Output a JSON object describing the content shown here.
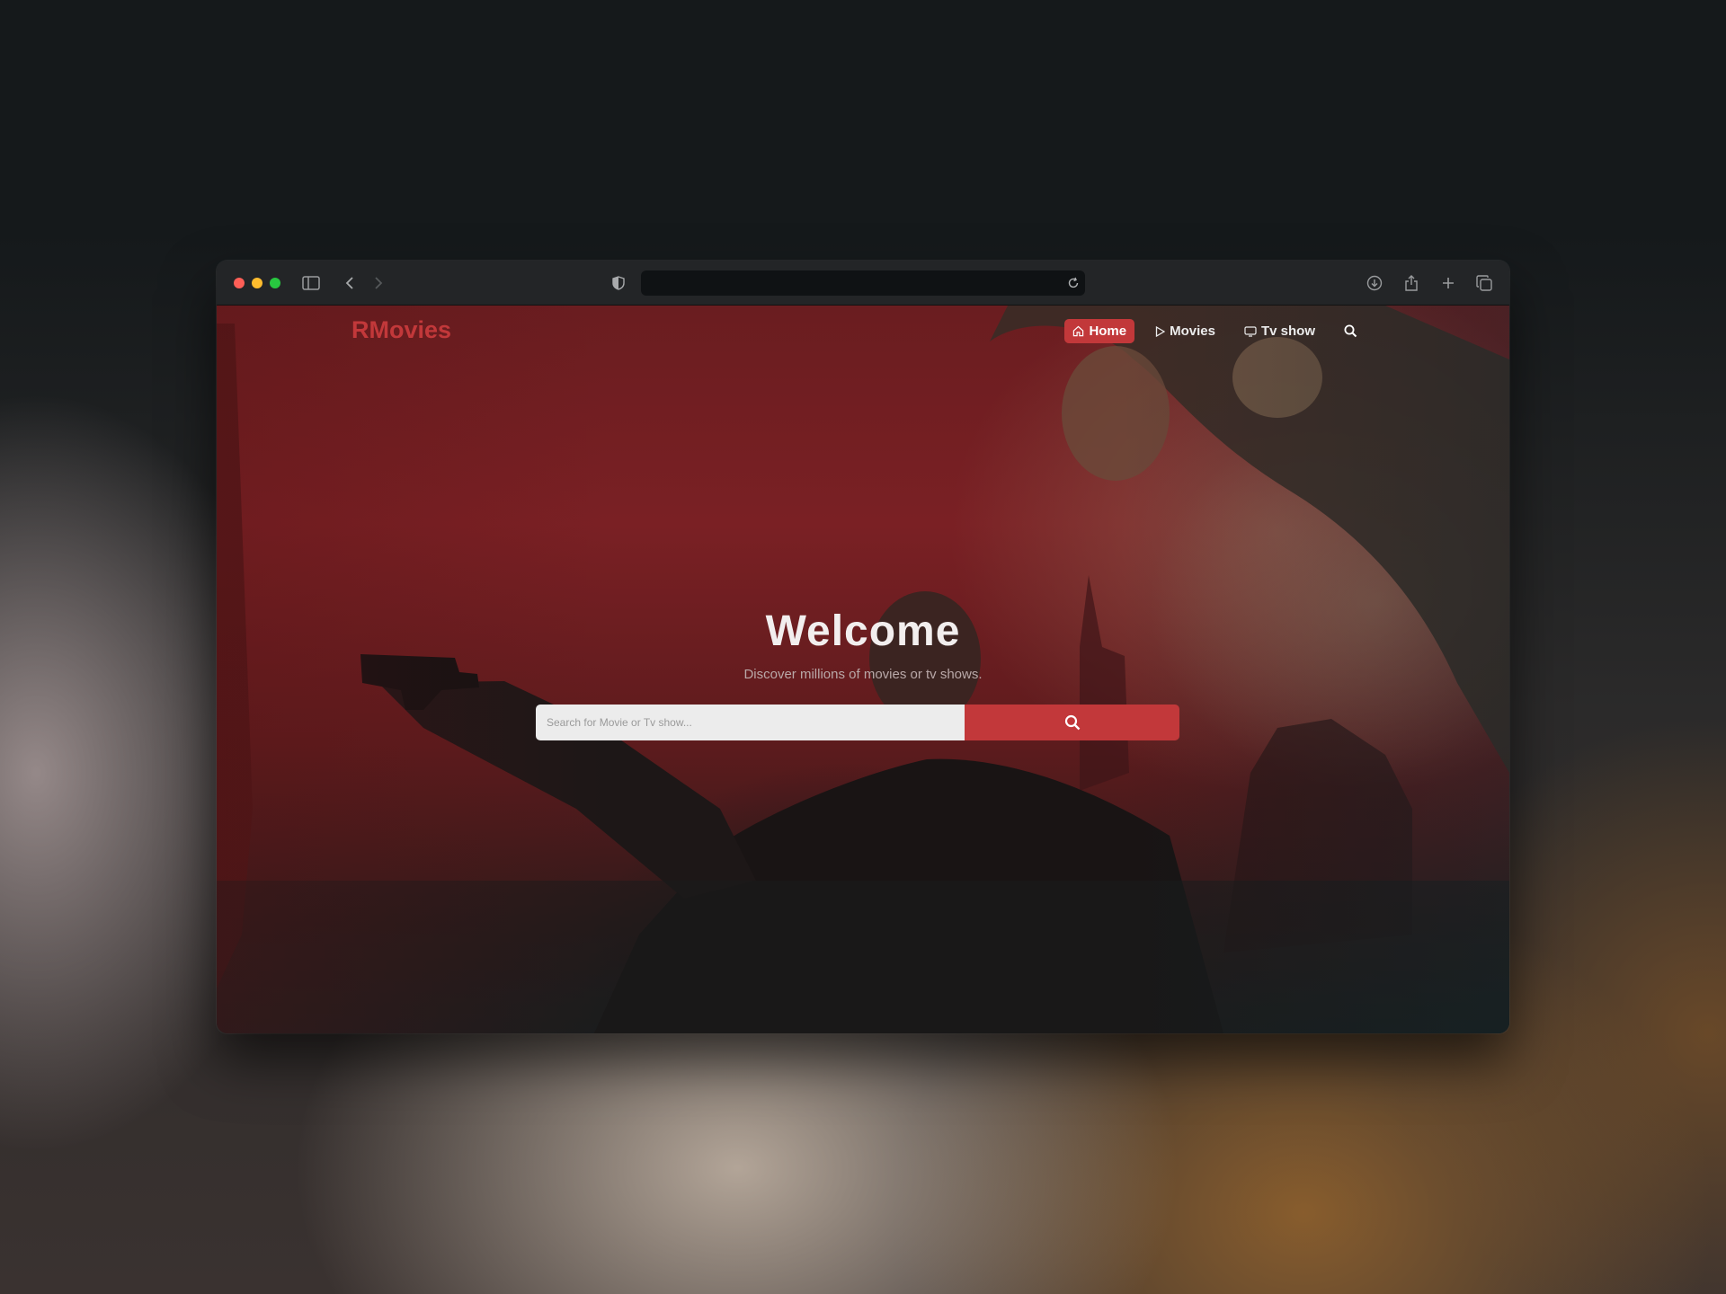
{
  "browser": {
    "address_text": "",
    "toolbar_icons": [
      "sidebar-icon",
      "back-icon",
      "forward-icon",
      "shield-icon",
      "reload-icon",
      "download-icon",
      "share-icon",
      "new-tab-icon",
      "tabs-overview-icon"
    ]
  },
  "site": {
    "logo": "RMovies",
    "nav": [
      {
        "label": "Home",
        "icon": "home-icon",
        "active": true
      },
      {
        "label": "Movies",
        "icon": "play-icon",
        "active": false
      },
      {
        "label": "Tv show",
        "icon": "tv-icon",
        "active": false
      }
    ],
    "accent_color": "#c2383a"
  },
  "hero": {
    "title": "Welcome",
    "subtitle": "Discover millions of movies or tv shows.",
    "search_placeholder": "Search for Movie or Tv show..."
  }
}
